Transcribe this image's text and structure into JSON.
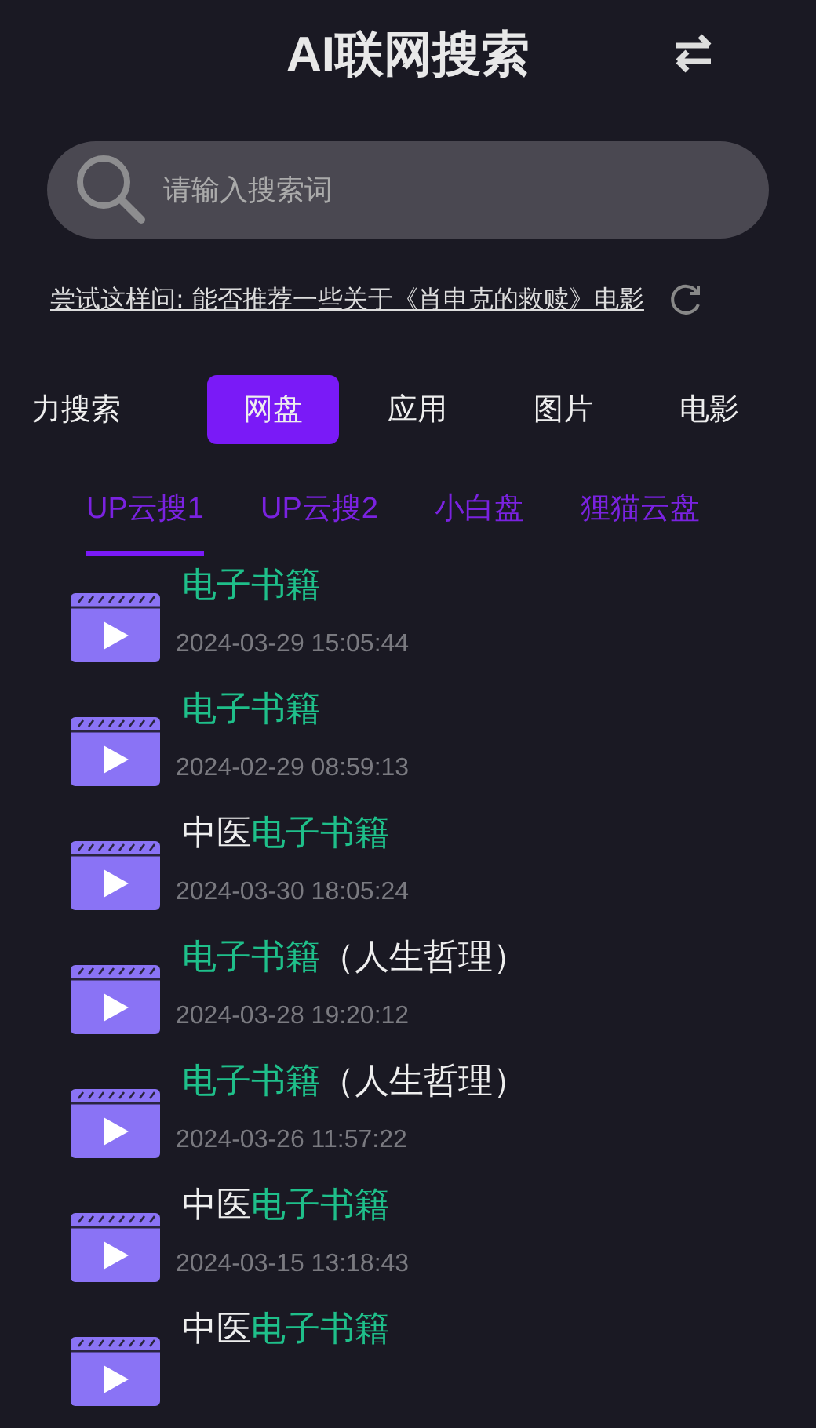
{
  "header": {
    "title": "AI联网搜索"
  },
  "search": {
    "placeholder": "请输入搜索词"
  },
  "suggestion": {
    "text": "尝试这样问: 能否推荐一些关于《肖申克的救赎》电影"
  },
  "category_tabs": [
    {
      "label": "力搜索",
      "selected": false
    },
    {
      "label": "网盘",
      "selected": true
    },
    {
      "label": "应用",
      "selected": false
    },
    {
      "label": "图片",
      "selected": false
    },
    {
      "label": "电影",
      "selected": false
    }
  ],
  "source_tabs": [
    {
      "label": "UP云搜1",
      "selected": true
    },
    {
      "label": "UP云搜2",
      "selected": false
    },
    {
      "label": "小白盘",
      "selected": false
    },
    {
      "label": "狸猫云盘",
      "selected": false
    }
  ],
  "results": [
    {
      "title": [
        {
          "text": "电子书籍",
          "highlight": true
        }
      ],
      "date": "2024-03-29 15:05:44"
    },
    {
      "title": [
        {
          "text": "电子书籍",
          "highlight": true
        }
      ],
      "date": "2024-02-29 08:59:13"
    },
    {
      "title": [
        {
          "text": "中医",
          "highlight": false
        },
        {
          "text": "电子书籍",
          "highlight": true
        }
      ],
      "date": "2024-03-30 18:05:24"
    },
    {
      "title": [
        {
          "text": "电子书籍",
          "highlight": true
        },
        {
          "text": "（人生哲理）",
          "highlight": false
        }
      ],
      "date": "2024-03-28 19:20:12"
    },
    {
      "title": [
        {
          "text": "电子书籍",
          "highlight": true
        },
        {
          "text": "（人生哲理）",
          "highlight": false
        }
      ],
      "date": "2024-03-26 11:57:22"
    },
    {
      "title": [
        {
          "text": "中医",
          "highlight": false
        },
        {
          "text": "电子书籍",
          "highlight": true
        }
      ],
      "date": "2024-03-15 13:18:43"
    },
    {
      "title": [
        {
          "text": "中医",
          "highlight": false
        },
        {
          "text": "电子书籍",
          "highlight": true
        }
      ]
    }
  ]
}
